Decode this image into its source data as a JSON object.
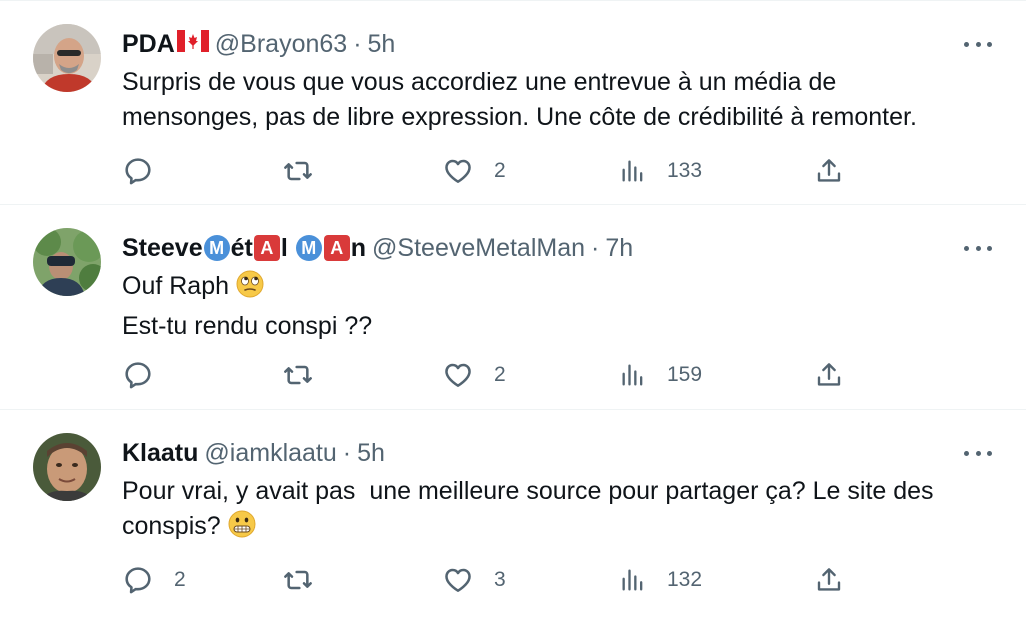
{
  "tweets": [
    {
      "name": "PDA",
      "flag_icon": "canada-flag-icon",
      "handle": "@Brayon63",
      "separator": "·",
      "time": "5h",
      "lines": [
        "Surpris de vous que vous accordiez une entrevue à un média de",
        "mensonges, pas de libre expression. Une côte de crédibilité à remonter."
      ],
      "replies": "",
      "retweets": "",
      "likes": "2",
      "views": "133"
    },
    {
      "name_parts": [
        "Steeve",
        "M",
        "ét",
        "A",
        "l ",
        "M",
        "A",
        "n"
      ],
      "handle": "@SteeveMetalMan",
      "separator": "·",
      "time": "7h",
      "lines": [
        "Ouf Raph",
        "Est-tu rendu conspi ??"
      ],
      "emoji_icon": "rolling-eyes-emoji-icon",
      "replies": "",
      "retweets": "",
      "likes": "2",
      "views": "159"
    },
    {
      "name": "Klaatu",
      "handle": "@iamklaatu",
      "separator": "·",
      "time": "5h",
      "lines": [
        "Pour vrai, y avait pas  une meilleure source pour partager ça? Le site des",
        "conspis?"
      ],
      "emoji_icon": "grimacing-face-emoji-icon",
      "replies": "2",
      "retweets": "",
      "likes": "3",
      "views": "132"
    }
  ],
  "colors": {
    "text": "#0f1419",
    "secondary": "#536471",
    "divider": "#eff3f4",
    "badge_blue": "#4a90d9",
    "badge_red": "#d93a3a"
  }
}
